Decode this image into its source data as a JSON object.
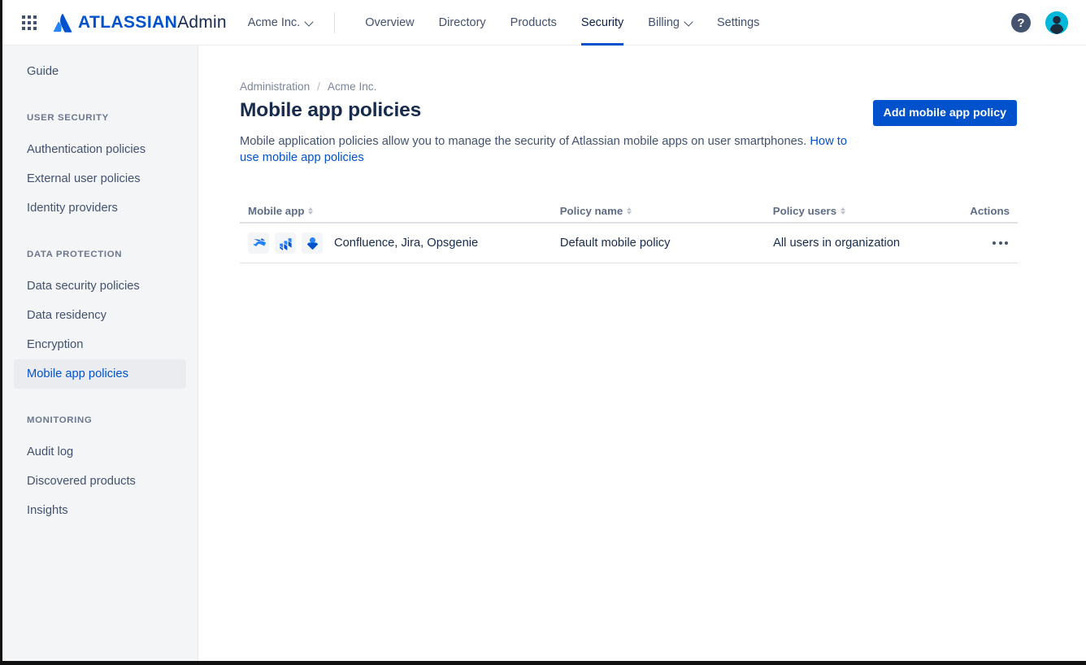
{
  "topnav": {
    "app_switcher": "app-switcher",
    "brand_bold": "ATLASSIAN",
    "brand_regular": "Admin",
    "org_switcher": "Acme Inc.",
    "tabs": [
      {
        "label": "Overview",
        "active": false,
        "has_chevron": false
      },
      {
        "label": "Directory",
        "active": false,
        "has_chevron": false
      },
      {
        "label": "Products",
        "active": false,
        "has_chevron": false
      },
      {
        "label": "Security",
        "active": true,
        "has_chevron": false
      },
      {
        "label": "Billing",
        "active": false,
        "has_chevron": true
      },
      {
        "label": "Settings",
        "active": false,
        "has_chevron": false
      }
    ],
    "help_label": "?",
    "avatar_label": "profile-avatar"
  },
  "sidebar": {
    "top_items": [
      {
        "label": "Guide",
        "selected": false
      }
    ],
    "sections": [
      {
        "title": "USER SECURITY",
        "items": [
          {
            "label": "Authentication policies",
            "selected": false
          },
          {
            "label": "External user policies",
            "selected": false
          },
          {
            "label": "Identity providers",
            "selected": false
          }
        ]
      },
      {
        "title": "DATA PROTECTION",
        "items": [
          {
            "label": "Data security policies",
            "selected": false
          },
          {
            "label": "Data residency",
            "selected": false
          },
          {
            "label": "Encryption",
            "selected": false
          },
          {
            "label": "Mobile app policies",
            "selected": true
          }
        ]
      },
      {
        "title": "MONITORING",
        "items": [
          {
            "label": "Audit log",
            "selected": false
          },
          {
            "label": "Discovered products",
            "selected": false
          },
          {
            "label": "Insights",
            "selected": false
          }
        ]
      }
    ]
  },
  "main": {
    "breadcrumb": {
      "root": "Administration",
      "separator": "/",
      "org": "Acme Inc."
    },
    "title": "Mobile app policies",
    "description_text": "Mobile application policies allow you to manage the security of Atlassian mobile apps on user smartphones. ",
    "description_link": "How to use mobile app policies",
    "add_button": "Add mobile app policy",
    "table": {
      "columns": [
        {
          "label": "Mobile app",
          "sortable": true
        },
        {
          "label": "Policy name",
          "sortable": true
        },
        {
          "label": "Policy users",
          "sortable": true
        },
        {
          "label": "Actions",
          "sortable": false
        }
      ],
      "rows": [
        {
          "apps": [
            "confluence-icon",
            "jira-icon",
            "opsgenie-icon"
          ],
          "app_names": "Confluence, Jira, Opsgenie",
          "policy_name": "Default mobile policy",
          "policy_users": "All users in organization",
          "actions": "more-actions"
        }
      ]
    }
  },
  "colors": {
    "brand_blue": "#0052cc",
    "text_primary": "#172b4d",
    "text_subtle": "#42526e",
    "sidebar_bg": "#f4f5f7",
    "selected_bg": "#ebecf0",
    "avatar_bg": "#00b8d9"
  }
}
